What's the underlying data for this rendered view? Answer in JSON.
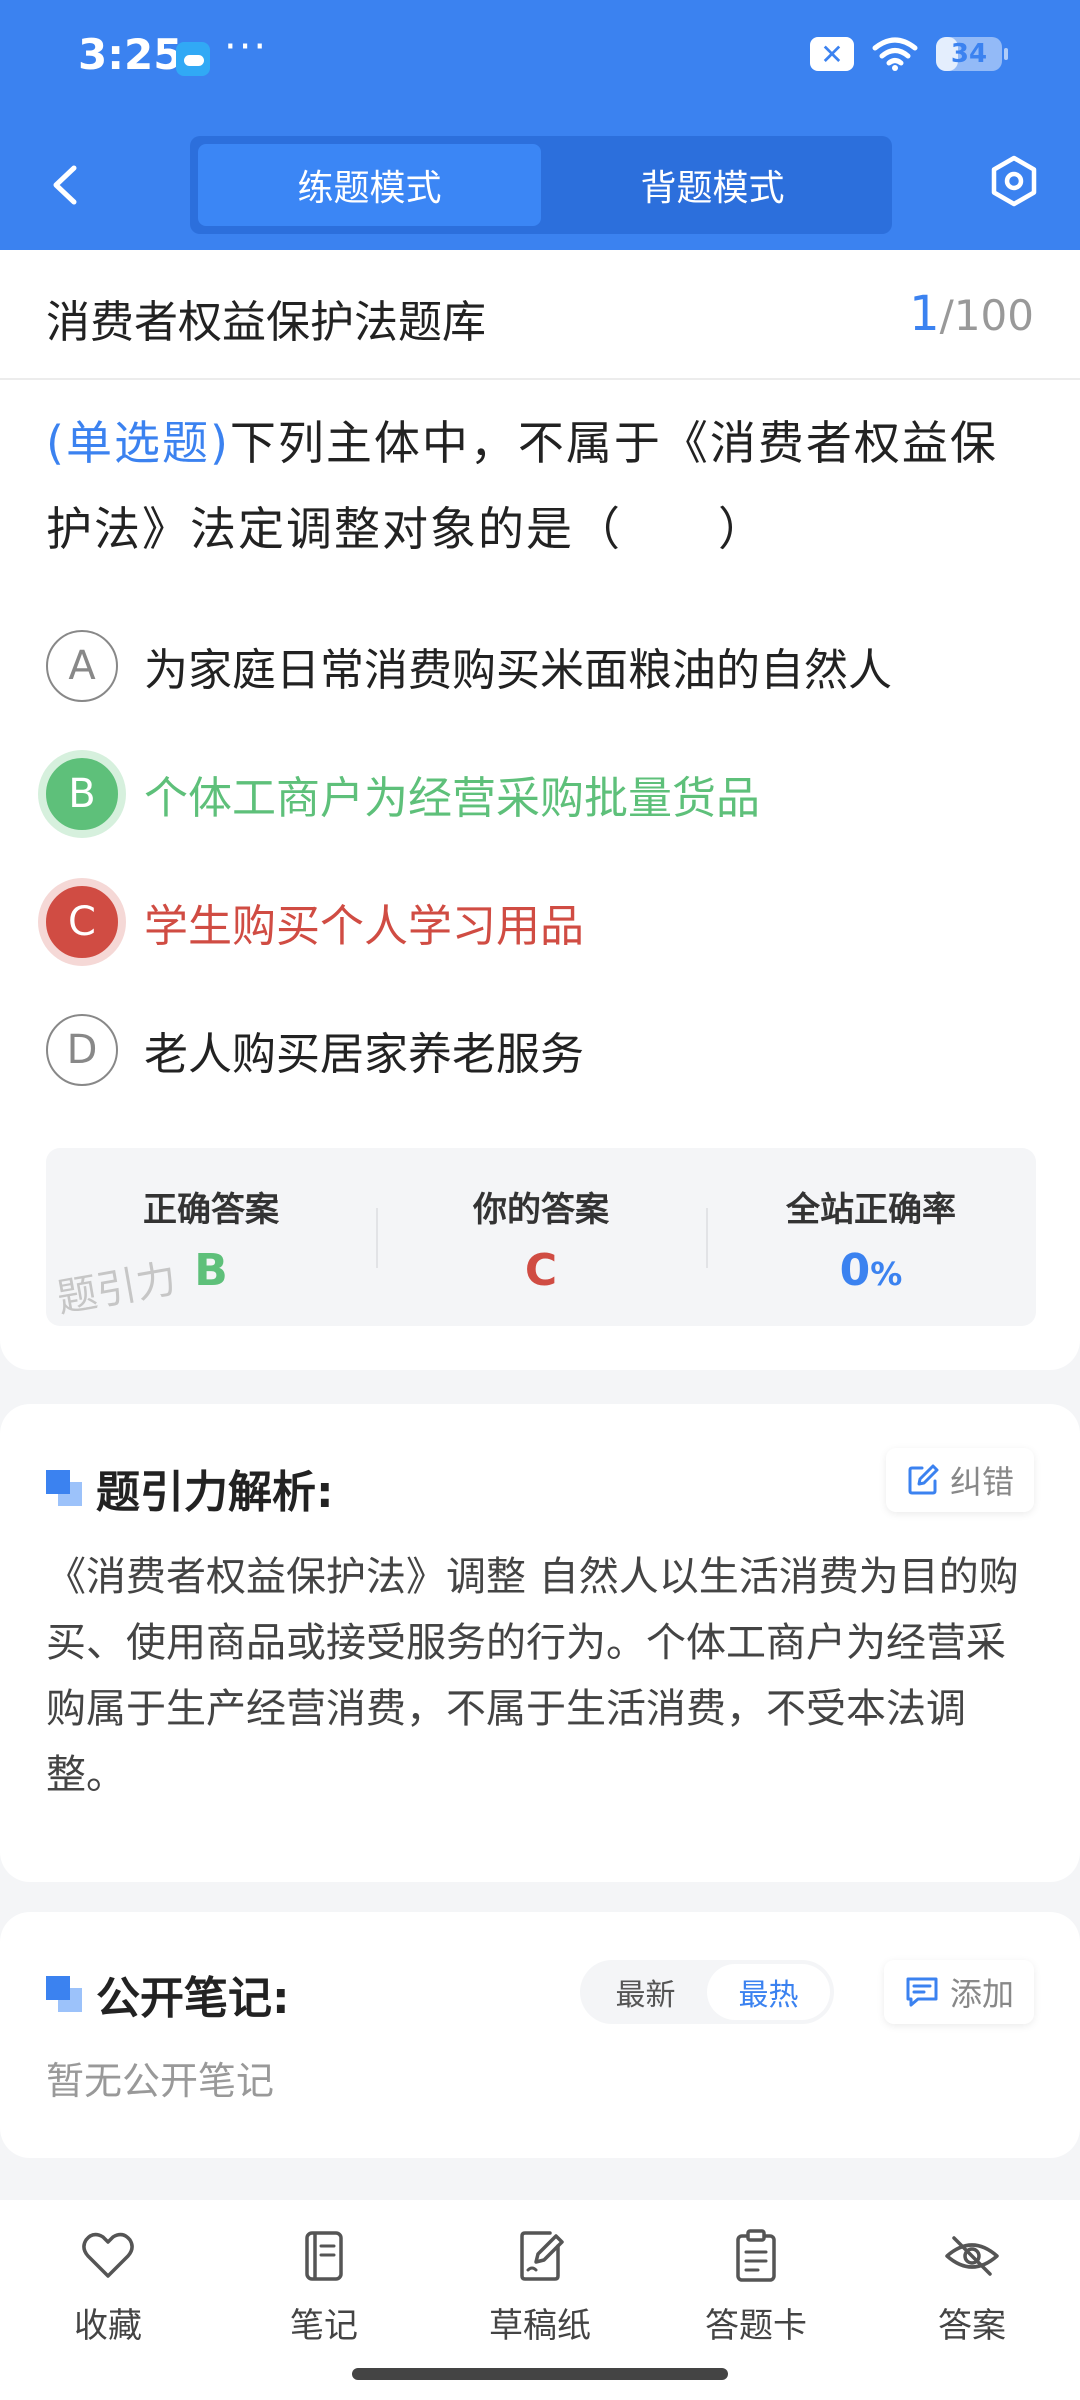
{
  "status_bar": {
    "time": "3:25",
    "dots": "···",
    "battery": "34",
    "battery_fraction": 0.34
  },
  "header": {
    "tabs": [
      {
        "label": "练题模式",
        "active": true
      },
      {
        "label": "背题模式",
        "active": false
      }
    ]
  },
  "question_bank": {
    "title": "消费者权益保护法题库",
    "current": "1",
    "total": "/100"
  },
  "question": {
    "type": "(单选题)",
    "text": "下列主体中，不属于《消费者权益保护法》法定调整对象的是（　　）"
  },
  "options": [
    {
      "letter": "A",
      "text": "为家庭日常消费购买米面粮油的自然人",
      "state": "normal"
    },
    {
      "letter": "B",
      "text": "个体工商户为经营采购批量货品",
      "state": "correct"
    },
    {
      "letter": "C",
      "text": "学生购买个人学习用品",
      "state": "wrong"
    },
    {
      "letter": "D",
      "text": "老人购买居家养老服务",
      "state": "normal"
    }
  ],
  "result": {
    "correct_label": "正确答案",
    "correct_value": "B",
    "yours_label": "你的答案",
    "yours_value": "C",
    "rate_label": "全站正确率",
    "rate_value": "0",
    "rate_unit": "%",
    "watermark": "题引力"
  },
  "analysis": {
    "title": "题引力解析:",
    "correction_label": "纠错",
    "text": "《消费者权益保护法》调整 自然人以生活消费为目的购买、使用商品或接受服务的行为。个体工商户为经营采购属于生产经营消费，不属于生活消费，不受本法调整。"
  },
  "notes": {
    "title": "公开笔记:",
    "sort_latest": "最新",
    "sort_hot": "最热",
    "add_label": "添加",
    "empty_text": "暂无公开笔记"
  },
  "bottom_bar": [
    {
      "label": "收藏",
      "icon": "heart-icon"
    },
    {
      "label": "笔记",
      "icon": "notebook-icon"
    },
    {
      "label": "草稿纸",
      "icon": "draft-paper-icon"
    },
    {
      "label": "答题卡",
      "icon": "answer-sheet-icon"
    },
    {
      "label": "答案",
      "icon": "eye-off-icon"
    }
  ],
  "colors": {
    "primary": "#3b82f0",
    "correct": "#5ec07a",
    "wrong": "#d04c43"
  }
}
